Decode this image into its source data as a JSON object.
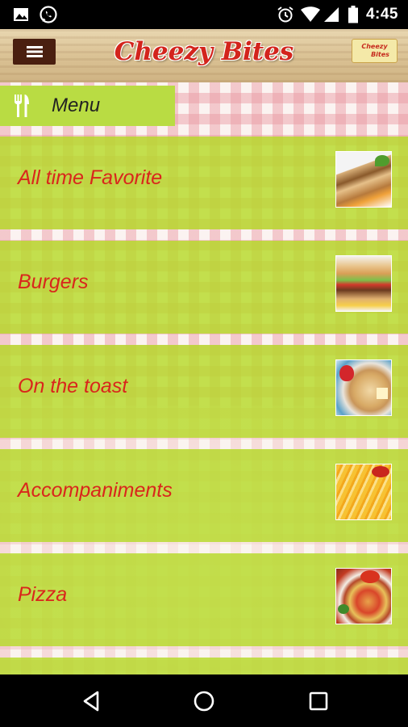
{
  "status_bar": {
    "time": "4:45",
    "left_icons": [
      "image-icon",
      "whatsapp-icon"
    ],
    "right_icons": [
      "alarm-icon",
      "wifi-icon",
      "signal-icon",
      "battery-icon"
    ]
  },
  "header": {
    "title": "Cheezy Bites",
    "logo_text_line1": "Cheezy",
    "logo_text_line2": "Bites",
    "menu_button_icon": "hamburger-icon"
  },
  "menu_header": {
    "label": "Menu",
    "icon": "fork-knife-icon"
  },
  "menu_items": [
    {
      "label": "All time Favorite",
      "thumb": "sandwich-image"
    },
    {
      "label": "Burgers",
      "thumb": "burger-image"
    },
    {
      "label": "On the toast",
      "thumb": "toast-image"
    },
    {
      "label": "Accompaniments",
      "thumb": "fries-image"
    },
    {
      "label": "Pizza",
      "thumb": "pizza-image"
    }
  ],
  "nav_bar": {
    "back_icon": "back-icon",
    "home_icon": "home-icon",
    "recents_icon": "recents-icon"
  },
  "colors": {
    "accent_green": "#b9dc43",
    "label_red": "#d9261c",
    "menu_button_brown": "#4a1f10"
  }
}
